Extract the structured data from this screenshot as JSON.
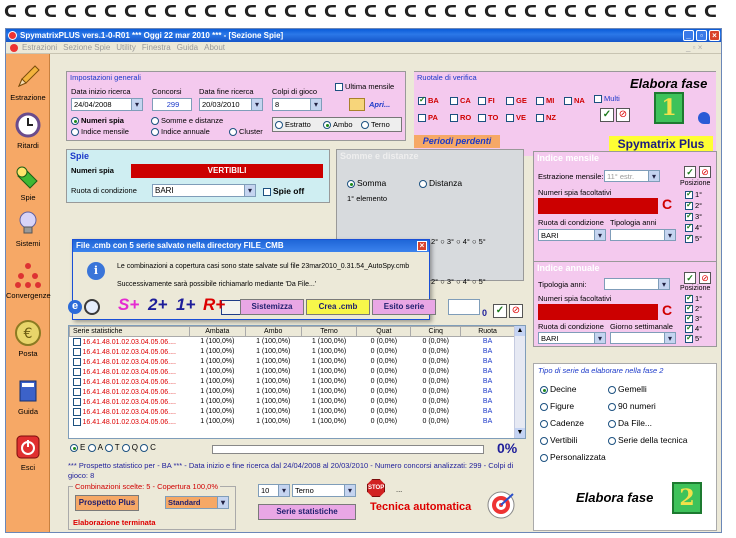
{
  "window": {
    "title": "SpymatrixPLUS vers.1-0-R01   ***  Oggi 22 mar 2010   ***  - [Sezione Spie]",
    "menu": [
      "Estrazioni",
      "Sezione Spie",
      "Utility",
      "Finestra",
      "Guida",
      "About"
    ]
  },
  "sidebar": {
    "items": [
      {
        "label": "Estrazione",
        "icon": "pencil-icon"
      },
      {
        "label": "Ritardi",
        "icon": "clock-icon"
      },
      {
        "label": "Spie",
        "icon": "flashlight-icon"
      },
      {
        "label": "Sistemi",
        "icon": "lightbulb-icon"
      },
      {
        "label": "Convergenze",
        "icon": "molecule-icon"
      },
      {
        "label": "Posta",
        "icon": "euro-coin-icon"
      },
      {
        "label": "Guida",
        "icon": "book-icon"
      },
      {
        "label": "Esci",
        "icon": "power-icon"
      }
    ]
  },
  "settings": {
    "title": "Impostazioni generali",
    "data_inizio_label": "Data inizio ricerca",
    "data_inizio": "24/04/2008",
    "concorsi_label": "Concorsi",
    "concorsi": "299",
    "data_fine_label": "Data fine ricerca",
    "data_fine": "20/03/2010",
    "colpi_label": "Colpi di gioco",
    "colpi": "8",
    "ultima_mensile": "Ultima mensile",
    "apri": "Apri...",
    "numeri_spia": "Numeri spia",
    "indice_mensile": "Indice mensile",
    "somme_distanze": "Somme e distanze",
    "indice_annuale": "Indice annuale",
    "cluster": "Cluster",
    "estratto": "Estratto",
    "ambo": "Ambo",
    "terno": "Terno"
  },
  "ruotale": {
    "title": "Ruotale di verifica",
    "row1": [
      "BA",
      "CA",
      "FI",
      "GE",
      "MI",
      "NA"
    ],
    "row2": [
      "PA",
      "RO",
      "TO",
      "VE",
      "NZ"
    ],
    "multi": "Multi",
    "elabora": "Elabora fase",
    "fase_num": "1"
  },
  "periodi": "Periodi perdenti",
  "brand": "Spymatrix Plus",
  "spie": {
    "title": "Spie",
    "numeri_spia": "Numeri spia",
    "vertibili": "VERTIBILI",
    "ruota_label": "Ruota di condizione",
    "ruota": "BARI",
    "spie_off": "Spie off"
  },
  "somme": {
    "title": "Somme e distanze",
    "somma": "Somma",
    "distanza": "Distanza",
    "elemento": "1° elemento",
    "ordinals": [
      "2°",
      "3°",
      "4°",
      "5°"
    ]
  },
  "dialog": {
    "title": "File .cmb con 5 serie salvato nella directory FILE_CMB",
    "line1": "Le combinazioni a copertura casi sono state salvate sul file 23mar2010_0.31.54_AutoSpy.cmb",
    "line2": "Successivamente sarà possibile richiamarlo mediante 'Da File...'",
    "ok": "OK"
  },
  "toolbar": {
    "s_plus": "S+",
    "two_plus": "2+",
    "one_plus": "1+",
    "r_plus": "R+",
    "sistemizza": "Sistemizza",
    "crea_cmb": "Crea .cmb",
    "esito": "Esito serie",
    "zero": "0"
  },
  "table": {
    "headers": [
      "Serie statistiche",
      "Ambata",
      "Ambo",
      "Terno",
      "Quat",
      "Cinq",
      "Ruota"
    ],
    "rows": [
      [
        "16.41.48.01.02.03.04.05.06....",
        "1 (100,0%)",
        "1 (100,0%)",
        "1 (100,0%)",
        "0 (0,0%)",
        "0 (0,0%)",
        "BA"
      ],
      [
        "16.41.48.01.02.03.04.05.06....",
        "1 (100,0%)",
        "1 (100,0%)",
        "1 (100,0%)",
        "0 (0,0%)",
        "0 (0,0%)",
        "BA"
      ],
      [
        "16.41.48.01.02.03.04.05.06....",
        "1 (100,0%)",
        "1 (100,0%)",
        "1 (100,0%)",
        "0 (0,0%)",
        "0 (0,0%)",
        "BA"
      ],
      [
        "16.41.48.01.02.03.04.05.06....",
        "1 (100,0%)",
        "1 (100,0%)",
        "1 (100,0%)",
        "0 (0,0%)",
        "0 (0,0%)",
        "BA"
      ],
      [
        "16.41.48.01.02.03.04.05.06....",
        "1 (100,0%)",
        "1 (100,0%)",
        "1 (100,0%)",
        "0 (0,0%)",
        "0 (0,0%)",
        "BA"
      ],
      [
        "16.41.48.01.02.03.04.05.06....",
        "1 (100,0%)",
        "1 (100,0%)",
        "1 (100,0%)",
        "0 (0,0%)",
        "0 (0,0%)",
        "BA"
      ],
      [
        "16.41.48.01.02.03.04.05.06....",
        "1 (100,0%)",
        "1 (100,0%)",
        "1 (100,0%)",
        "0 (0,0%)",
        "0 (0,0%)",
        "BA"
      ],
      [
        "16.41.48.01.02.03.04.05.06....",
        "1 (100,0%)",
        "1 (100,0%)",
        "1 (100,0%)",
        "0 (0,0%)",
        "0 (0,0%)",
        "BA"
      ],
      [
        "16.41.48.01.02.03.04.05.06....",
        "1 (100,0%)",
        "1 (100,0%)",
        "1 (100,0%)",
        "0 (0,0%)",
        "0 (0,0%)",
        "BA"
      ]
    ]
  },
  "filter": {
    "options": [
      "E",
      "A",
      "T",
      "Q",
      "C"
    ],
    "progress_pct": "0%",
    "progress_value": 0
  },
  "prospetto": {
    "line": "*** Prospetto statistico per  - BA *** - Data inizio e fine ricerca dal 24/04/2008 al 20/03/2010 - Numero concorsi analizzati: 299 - Colpi di gioco: 8",
    "combinazioni": "Combinazioni scelte: 5 - Copertura 100,0%",
    "prospetto_plus": "Prospetto Plus",
    "standard": "Standard",
    "elaborazione": "Elaborazione terminata",
    "colpi_val": "10",
    "terno": "Terno",
    "stop": "STOP",
    "dots": "...",
    "serie": "Serie statistiche",
    "tecnica": "Tecnica automatica"
  },
  "mensile": {
    "title": "Indice mensile",
    "estrazione_label": "Estrazione mensile:",
    "estrazione": "11° estr.",
    "facoltativi": "Numeri spia facoltativi",
    "c": "C",
    "ruota_label": "Ruota di condizione",
    "tipologia_label": "Tipologia anni",
    "ruota": "BARI",
    "posizione": "Posizione",
    "positions": [
      "1°",
      "2°",
      "3°",
      "4°",
      "5°"
    ]
  },
  "annuale": {
    "title": "Indice annuale",
    "tipologia_label": "Tipologia anni:",
    "facoltativi": "Numeri spia facoltativi",
    "c": "C",
    "ruota_label": "Ruota di condizione",
    "giorno_label": "Giorno settimanale",
    "ruota": "BARI",
    "posizione": "Posizione",
    "positions": [
      "1°",
      "2°",
      "3°",
      "4°",
      "5°"
    ]
  },
  "fase2": {
    "title": "Tipo di serie da elaborare nella fase 2",
    "left": [
      "Decine",
      "Figure",
      "Cadenze",
      "Vertibili",
      "Personalizzata"
    ],
    "right": [
      "Gemelli",
      "90 numeri",
      "Da File...",
      "Serie della tecnica"
    ],
    "elabora": "Elabora fase",
    "fase_num": "2"
  },
  "colors": {
    "titlebar": "#0a5bd9",
    "sidebar": "#f6a866",
    "pink_panel": "#f4c9ee",
    "cyan_panel": "#cfeef2",
    "red_bar": "#cc0000",
    "accent_blue": "#1b39c9"
  }
}
